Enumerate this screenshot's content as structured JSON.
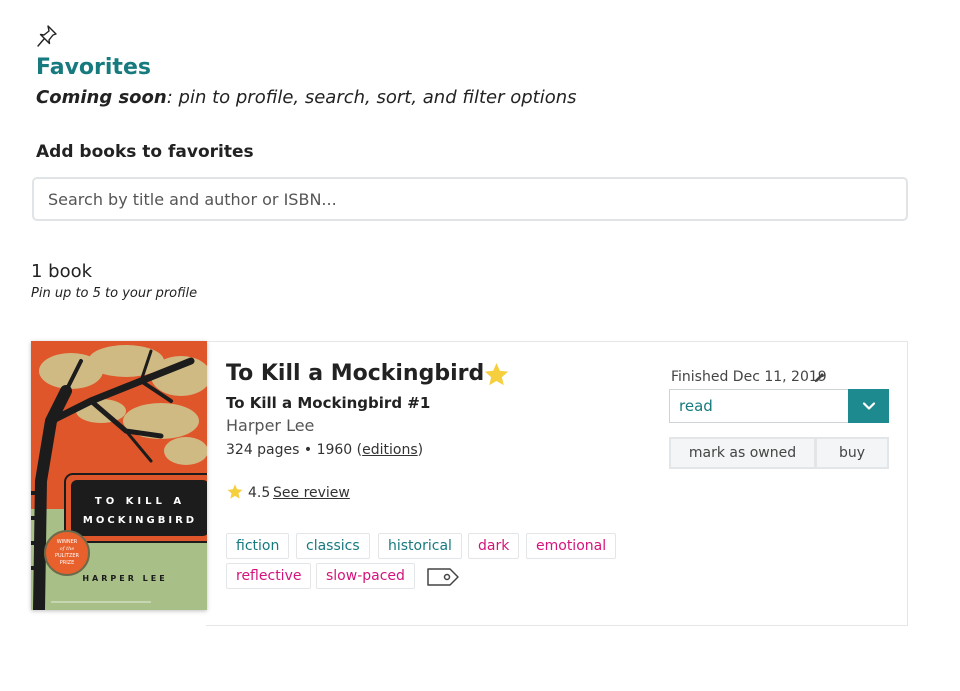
{
  "header": {
    "title": "Favorites",
    "subtitle_emphasis": "Coming soon",
    "subtitle_rest": ": pin to profile, search, sort, and filter options"
  },
  "add_section": {
    "heading": "Add books to favorites",
    "search_placeholder": "Search by title and author or ISBN..."
  },
  "list": {
    "count_label": "1 book",
    "pin_note": "Pin up to 5 to your profile"
  },
  "book": {
    "title": "To Kill a Mockingbird",
    "series": "To Kill a Mockingbird #1",
    "author": "Harper Lee",
    "pages_year": "324 pages • 1960 (",
    "editions_link": "editions",
    "close_paren": ")",
    "rating": "4.5",
    "see_review": "See review",
    "cover": {
      "title_line1": "TO KILL A",
      "title_line2": "MOCKINGBIRD",
      "author": "HARPER LEE",
      "badge_line1": "WINNER",
      "badge_line2": "of the",
      "badge_line3": "PULITZER",
      "badge_line4": "PRIZE"
    },
    "tags": [
      {
        "label": "fiction",
        "kind": "genre"
      },
      {
        "label": "classics",
        "kind": "genre"
      },
      {
        "label": "historical",
        "kind": "genre"
      },
      {
        "label": "dark",
        "kind": "mood"
      },
      {
        "label": "emotional",
        "kind": "mood"
      },
      {
        "label": "reflective",
        "kind": "mood"
      },
      {
        "label": "slow-paced",
        "kind": "mood"
      }
    ],
    "finished_label": "Finished Dec 11, 2019",
    "status": "read",
    "owned_button": "mark as owned",
    "buy_button": "buy"
  },
  "colors": {
    "accent": "#167a7e",
    "mood": "#d5137b",
    "star": "#f6cf3f"
  },
  "icons": [
    "pin-icon",
    "favorite-star-icon",
    "rating-star-icon",
    "edit-pencil-icon",
    "chevron-down-icon",
    "tag-add-icon"
  ]
}
